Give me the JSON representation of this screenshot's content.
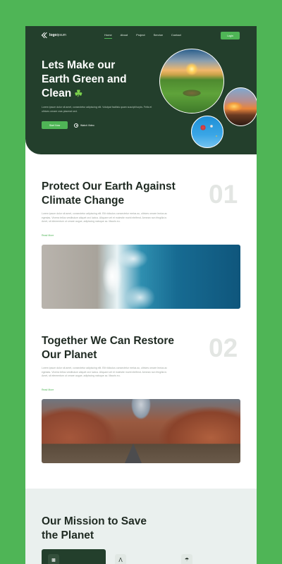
{
  "colors": {
    "brand": "#4fb556",
    "dark": "#233f2c",
    "text": "#1f2a22",
    "muted": "#9aa19b"
  },
  "nav": {
    "logo_bold": "logo",
    "logo_light": "ipsum",
    "links": [
      {
        "label": "Home",
        "active": true
      },
      {
        "label": "About"
      },
      {
        "label": "Project"
      },
      {
        "label": "Service"
      },
      {
        "label": "Contact"
      }
    ],
    "login": "Login"
  },
  "hero": {
    "title": "Lets Make our Earth Green and Clean",
    "title_emoji": "☘",
    "description": "Lorem ipsum dolor sit amet, consectetur adipiscing elit. Volutpat facilisis quam suscipit turpis. Felis et ultrices ornare cras placerat sed.",
    "start_button": "Start Now",
    "watch_link": "Watch Video",
    "play_icon": "play-circle-icon"
  },
  "sections": [
    {
      "title": "Protect Our Earth Against Climate Change",
      "number": "01",
      "description": "Lorem ipsum dolor sit amet, consectetur adipiscing elit. Elit ridiculus consectetur metus ac, ultrices ornare lectus ac egestas. Viverra tellus vestibulum aliquet orci luctus. Aliquam vel et molestie morbi eleifend. Aenean non fringilla in. Amet, sit elementum ut ornare augue, adipiscing natoque ac. Mauris eu.",
      "read_more": "Read More"
    },
    {
      "title": "Together We Can Restore Our Planet",
      "number": "02",
      "description": "Lorem ipsum dolor sit amet, consectetur adipiscing elit. Elit ridiculus consectetur metus ac, ultrices ornare lectus ac egestas. Viverra tellus vestibulum aliquet orci luctus. Aliquam vel et molestie morbi eleifend. Aenean non fringilla in. Amet, sit elementum ut ornare augue, adipiscing natoque ac. Mauris eu.",
      "read_more": "Read More"
    }
  ],
  "mission": {
    "title": "Our Mission to Save the Planet",
    "icons": [
      "bus-icon",
      "recycle-icon",
      "tree-icon"
    ]
  }
}
